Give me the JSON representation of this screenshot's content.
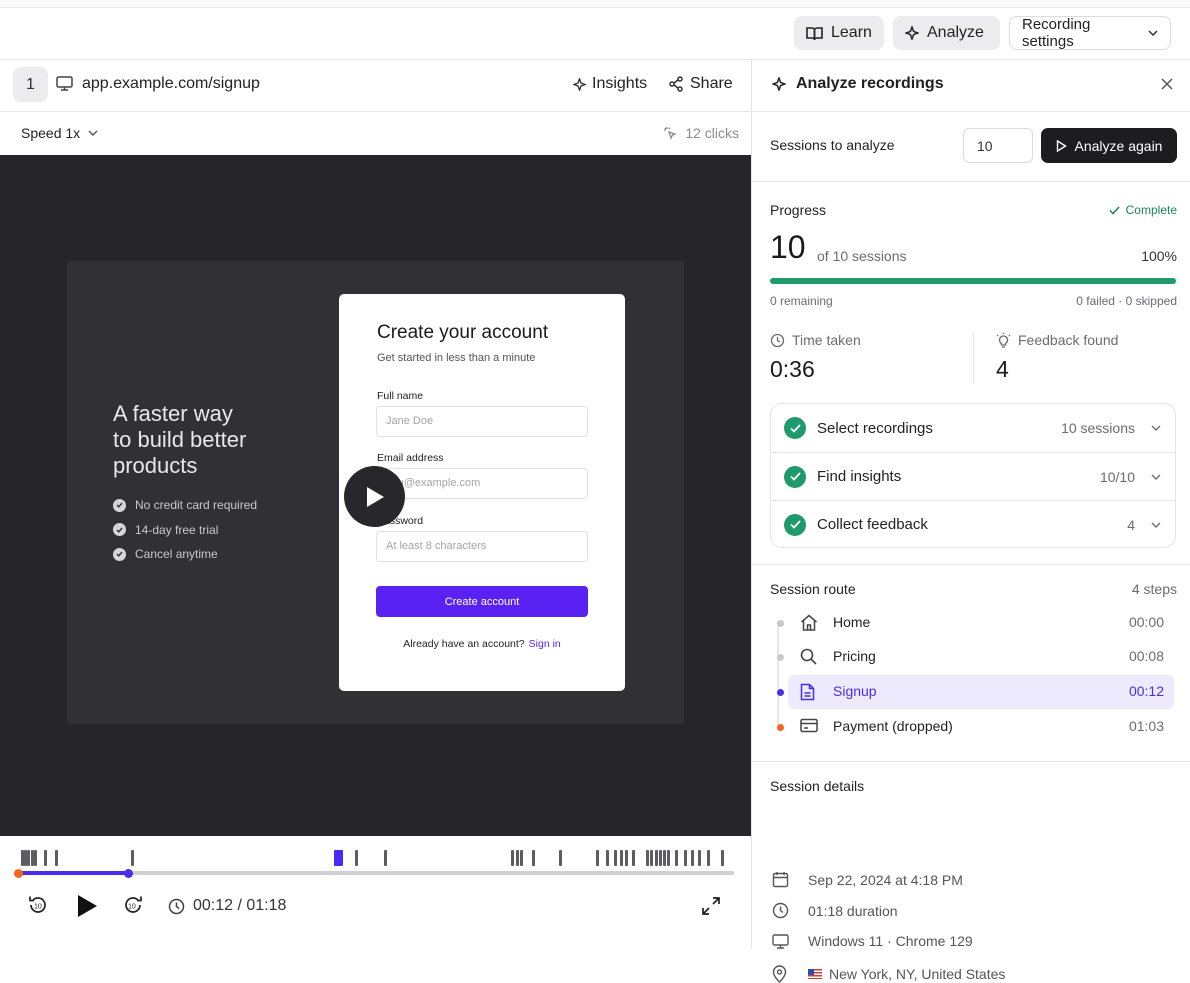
{
  "topbar": {
    "learn_label": "Learn",
    "analyze_label": "Analyze",
    "recording_settings_label": "Recording settings"
  },
  "player": {
    "recording_index": "1",
    "url": "app.example.com/signup",
    "insights_label": "Insights",
    "share_label": "Share",
    "speed_label": "Speed 1x",
    "clicks_label": "12 clicks",
    "time_display": "00:12 / 01:18",
    "progress_fraction": 0.154
  },
  "recording_page": {
    "hero_lines": [
      "A faster way",
      "to build better",
      "products"
    ],
    "checklist": [
      "No credit card required",
      "14-day free trial",
      "Cancel anytime"
    ],
    "form_title": "Create your account",
    "form_subtitle": "Get started in less than a minute",
    "fields": [
      {
        "label": "Full name",
        "placeholder": "Jane Doe"
      },
      {
        "label": "Email address",
        "placeholder": "you@example.com"
      },
      {
        "label": "Password",
        "placeholder": "At least 8 characters"
      }
    ],
    "submit_label": "Create account",
    "footer_text": "Already have an account?",
    "signin_label": "Sign in"
  },
  "panel": {
    "title": "Analyze recordings",
    "sessions_label": "Sessions to analyze",
    "sessions_value": "10",
    "analyze_again_label": "Analyze again",
    "progress": {
      "label": "Progress",
      "status": "Complete",
      "count": "10",
      "of_text": "of 10 sessions",
      "percent": "100%",
      "fraction": 1.0,
      "remaining": "0 remaining",
      "failed_skipped": "0 failed · 0 skipped"
    },
    "time_taken_label": "Time taken",
    "time_taken_value": "0:36",
    "feedback_label": "Feedback found",
    "feedback_value": "4",
    "steps": [
      {
        "label": "Select recordings",
        "meta": "10 sessions"
      },
      {
        "label": "Find insights",
        "meta": "10/10"
      },
      {
        "label": "Collect feedback",
        "meta": "4"
      }
    ],
    "route": {
      "title": "Session route",
      "steps_count": "4 steps",
      "items": [
        {
          "name": "Home",
          "time": "00:00",
          "icon": "home-icon"
        },
        {
          "name": "Pricing",
          "time": "00:08",
          "icon": "search-icon"
        },
        {
          "name": "Signup",
          "time": "00:12",
          "icon": "document-icon"
        },
        {
          "name": "Payment (dropped)",
          "time": "01:03",
          "icon": "credit-card-icon"
        }
      ]
    },
    "details": {
      "title": "Session details",
      "date": "Sep 22, 2024 at 4:18 PM",
      "duration": "01:18 duration",
      "environment": "Windows 11 · Chrome 129",
      "location": "New York, NY, United States"
    }
  },
  "colors": {
    "accent": "#4a2cf0",
    "success": "#1f9a6d",
    "dropped": "#f26522",
    "video_bg": "#25252a"
  }
}
